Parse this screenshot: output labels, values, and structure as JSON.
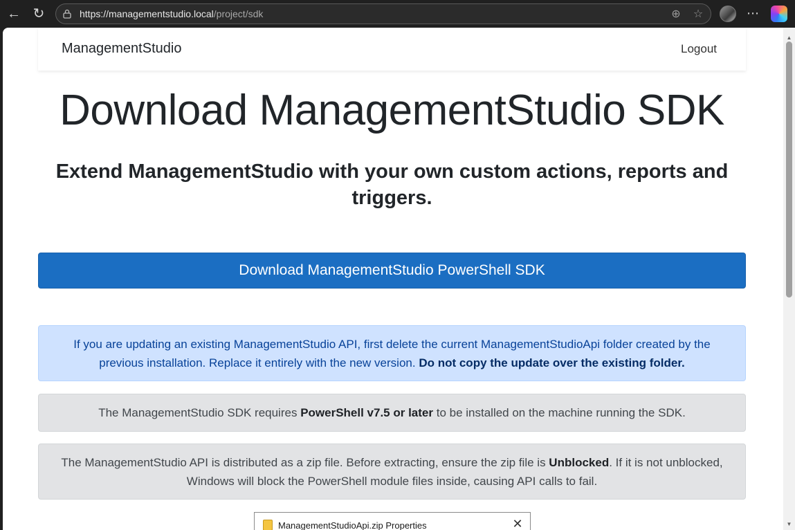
{
  "browser": {
    "url_host": "https://managementstudio.local",
    "url_path": "/project/sdk",
    "icons": {
      "back": "arrow-left-icon",
      "reload": "reload-icon",
      "lock": "lock-icon",
      "zoom": "zoom-icon",
      "favorite": "star-icon",
      "more": "more-icon"
    }
  },
  "navbar": {
    "brand": "ManagementStudio",
    "logout": "Logout"
  },
  "page": {
    "title": "Download ManagementStudio SDK",
    "subtitle": "Extend ManagementStudio with your own custom actions, reports and triggers.",
    "download_button": "Download ManagementStudio PowerShell SDK",
    "info_alert": {
      "text": "If you are updating an existing ManagementStudio API, first delete the current ManagementStudioApi folder created by the previous installation. Replace it entirely with the new version. ",
      "bold": "Do not copy the update over the existing folder."
    },
    "requirement_alert": {
      "pre": "The ManagementStudio SDK requires ",
      "bold": "PowerShell v7.5 or later",
      "post": " to be installed on the machine running the SDK."
    },
    "unblock_alert": {
      "pre": "The ManagementStudio API is distributed as a zip file. Before extracting, ensure the zip file is ",
      "bold": "Unblocked",
      "post": ". If it is not unblocked, Windows will block the PowerShell module files inside, causing API calls to fail."
    },
    "dialog": {
      "title": "ManagementStudioApi.zip Properties",
      "close": "✕"
    }
  },
  "colors": {
    "primary": "#1b6ec2",
    "info_bg": "#cfe2ff",
    "info_text": "#084298",
    "gray_bg": "#e2e3e5"
  }
}
